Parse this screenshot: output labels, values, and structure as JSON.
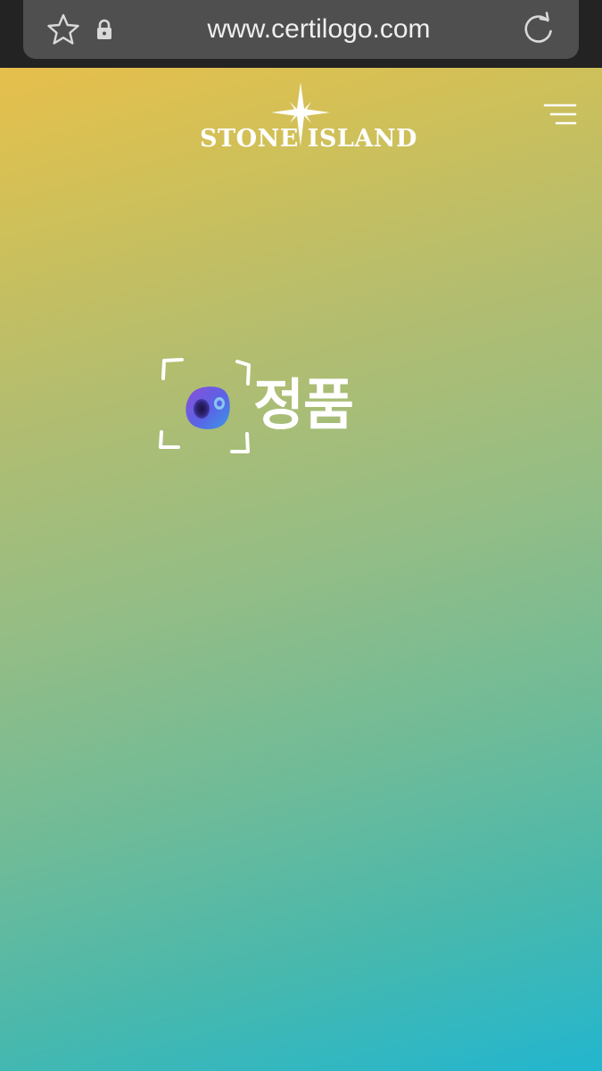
{
  "browser": {
    "url": "www.certilogo.com",
    "icons": {
      "bookmark": "star-icon",
      "security": "lock-icon",
      "refresh": "reload-icon"
    }
  },
  "header": {
    "brand_name": "STONE ISLAND",
    "logo_icon": "compass-icon",
    "menu_icon": "menu-icon"
  },
  "main": {
    "genuine_label": "정품",
    "scan_icon": "scan-frame-icon",
    "camera_icon": "camera-icon"
  },
  "colors": {
    "chrome_bg": "#232323",
    "url_pill": "#4f4f4f",
    "gradient_top": "#e6bf4c",
    "gradient_mid": "#93bd86",
    "gradient_bottom": "#22b6cf",
    "text_white": "#ffffff"
  }
}
